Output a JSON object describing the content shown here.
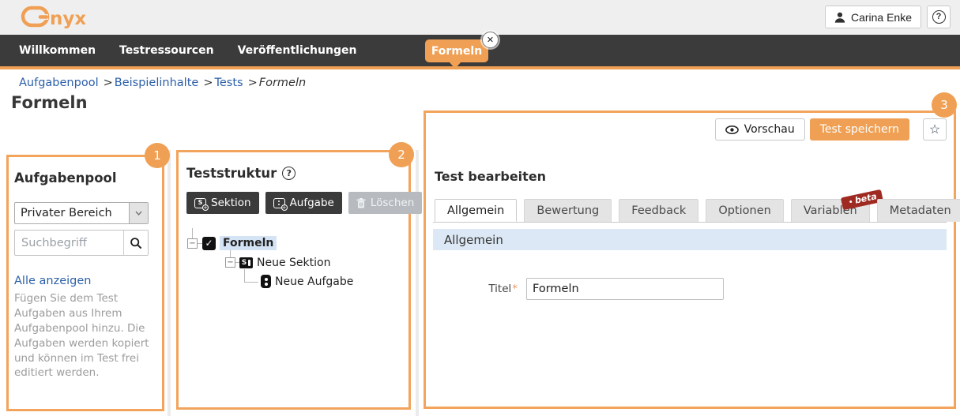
{
  "colors": {
    "accent": "#F0A054",
    "nav_dark": "#3B3B3B",
    "link_blue": "#2B5FA8",
    "beta_red": "#9E2A22"
  },
  "icons": {
    "close": "✕",
    "star": "☆",
    "question_mark": "?",
    "minus": "−",
    "check": "✓",
    "plus": "+"
  },
  "header": {
    "logo_text": "nyx",
    "user_button": "Carina Enke"
  },
  "nav": {
    "items": [
      "Willkommen",
      "Testressourcen",
      "Veröffentlichungen"
    ],
    "open_tab": {
      "label": "Formeln"
    }
  },
  "breadcrumb": {
    "separator": ">",
    "links": [
      "Aufgabenpool",
      "Beispielinhalte",
      "Tests"
    ],
    "current": "Formeln"
  },
  "page_title": "Formeln",
  "aufgabenpool_panel": {
    "badge": "1",
    "title": "Aufgabenpool",
    "pool_select_value": "Privater Bereich",
    "search_placeholder": "Suchbegriff",
    "show_all_link": "Alle anzeigen",
    "hint_text": "Fügen Sie dem Test Aufgaben aus Ihrem Aufgabenpool hinzu. Die Aufgaben werden kopiert und können im Test frei editiert werden."
  },
  "teststruktur_panel": {
    "badge": "2",
    "title": "Teststruktur",
    "buttons": {
      "sektion": "Sektion",
      "aufgabe": "Aufgabe",
      "loeschen": "Löschen"
    },
    "section_icon_letter": "S",
    "tree": {
      "root": "Formeln",
      "section": "Neue Sektion",
      "task": "Neue Aufgabe"
    }
  },
  "editor_panel": {
    "badge": "3",
    "preview_button": "Vorschau",
    "save_button": "Test speichern",
    "heading": "Test bearbeiten",
    "tabs": [
      "Allgemein",
      "Bewertung",
      "Feedback",
      "Optionen",
      "Variablen",
      "Metadaten"
    ],
    "beta_badge": "beta",
    "section_header": "Allgemein",
    "titel_label": "Titel",
    "required_marker": "*",
    "titel_value": "Formeln"
  }
}
